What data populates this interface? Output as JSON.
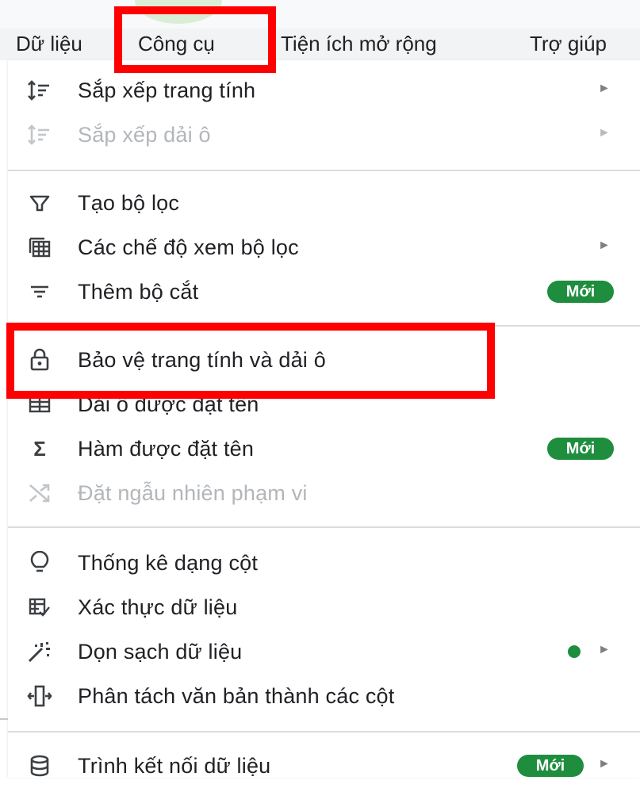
{
  "menubar": {
    "items": [
      "Dữ liệu",
      "Công cụ",
      "Tiện ích mở rộng",
      "Trợ giúp"
    ]
  },
  "menu": {
    "items": [
      {
        "icon": "sort-sheet-icon",
        "label": "Sắp xếp trang tính",
        "submenu": true,
        "disabled": false
      },
      {
        "icon": "sort-range-icon",
        "label": "Sắp xếp dải ô",
        "submenu": true,
        "disabled": true
      },
      {
        "icon": "filter-icon",
        "label": "Tạo bộ lọc",
        "submenu": false,
        "disabled": false
      },
      {
        "icon": "filter-views-icon",
        "label": "Các chế độ xem bộ lọc",
        "submenu": true,
        "disabled": false
      },
      {
        "icon": "slicer-icon",
        "label": "Thêm bộ cắt",
        "badge": "Mới",
        "disabled": false
      },
      {
        "icon": "lock-icon",
        "label": "Bảo vệ trang tính và dải ô",
        "disabled": false
      },
      {
        "icon": "named-ranges-icon",
        "label": "Dải ô được đặt tên",
        "disabled": false
      },
      {
        "icon": "sigma-icon",
        "label": "Hàm được đặt tên",
        "badge": "Mới",
        "disabled": false
      },
      {
        "icon": "shuffle-icon",
        "label": "Đặt ngẫu nhiên phạm vi",
        "disabled": true
      },
      {
        "icon": "lightbulb-icon",
        "label": "Thống kê dạng cột",
        "disabled": false
      },
      {
        "icon": "data-validation-icon",
        "label": "Xác thực dữ liệu",
        "disabled": false
      },
      {
        "icon": "magic-wand-icon",
        "label": "Dọn sạch dữ liệu",
        "submenu": true,
        "dot": true,
        "disabled": false
      },
      {
        "icon": "split-columns-icon",
        "label": "Phân tách văn bản thành các cột",
        "disabled": false
      },
      {
        "icon": "database-icon",
        "label": "Trình kết nối dữ liệu",
        "badge": "Mới",
        "submenu": true,
        "disabled": false
      }
    ]
  },
  "colors": {
    "badge": "#1e8e3e",
    "highlight": "#ff0000",
    "disabled_text": "#b3b6ba"
  }
}
